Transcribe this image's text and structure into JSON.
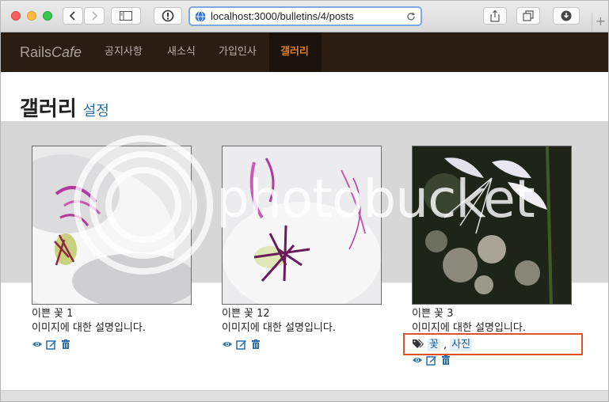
{
  "browser": {
    "url": "localhost:3000/bulletins/4/posts",
    "new_tab_glyph": "+"
  },
  "navbar": {
    "brand_prefix": "Rails",
    "brand_suffix": "Cafe",
    "items": [
      {
        "label": "공지사항"
      },
      {
        "label": "새소식"
      },
      {
        "label": "가입인사"
      },
      {
        "label": "갤러리"
      }
    ],
    "active_color": "#e27d2a"
  },
  "page": {
    "title": "갤러리",
    "settings_label": "설정"
  },
  "posts": [
    {
      "title": "이쁜 꽃 1",
      "description": "이미지에 대한 설명입니다.",
      "tags": []
    },
    {
      "title": "이쁜 꽃 12",
      "description": "이미지에 대한 설명입니다.",
      "tags": []
    },
    {
      "title": "이쁜 꽃 3",
      "description": "이미지에 대한 설명입니다.",
      "tags": [
        "꽃",
        "사진"
      ],
      "tag_separator": ","
    }
  ],
  "icons": [
    "eye-icon",
    "edit-icon",
    "trash-icon",
    "tags-icon"
  ],
  "watermark": {
    "text": "photobucket"
  },
  "colors": {
    "link": "#2a6fa8",
    "highlight": "#e0502c"
  }
}
